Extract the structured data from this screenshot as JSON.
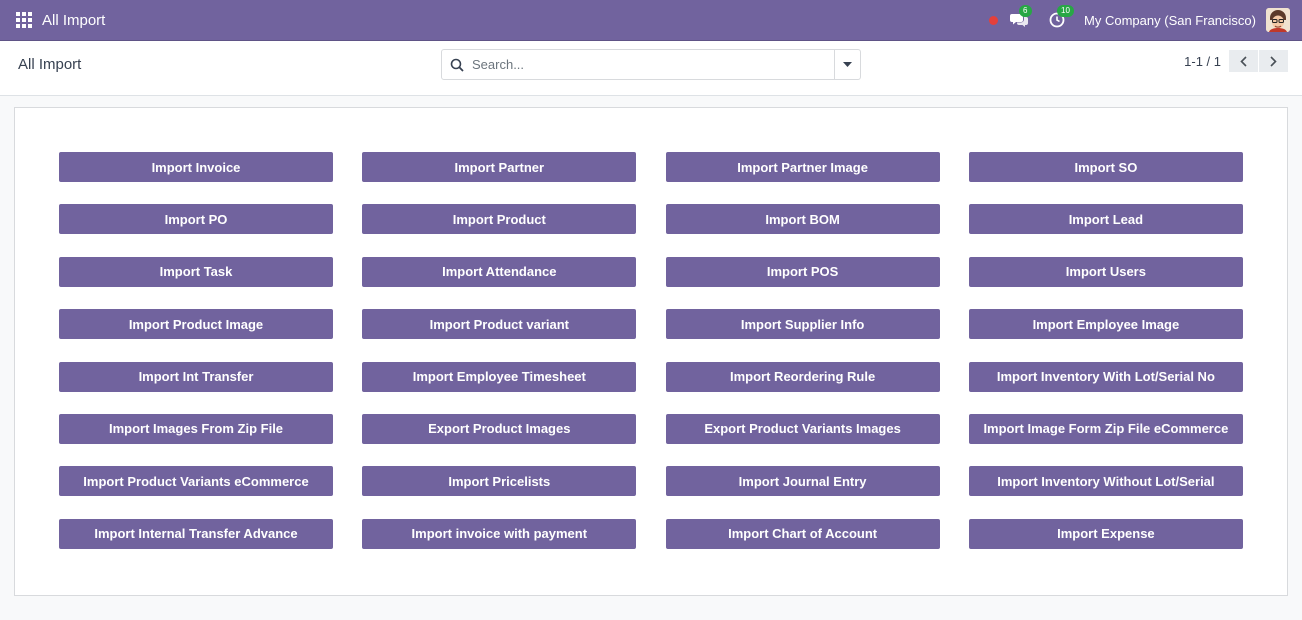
{
  "navbar": {
    "app_title": "All Import",
    "messages_count": "6",
    "activities_count": "10",
    "company": "My Company (San Francisco)"
  },
  "control_panel": {
    "breadcrumb": "All Import",
    "search_placeholder": "Search...",
    "pager": "1-1 / 1"
  },
  "buttons": [
    "Import Invoice",
    "Import Partner",
    "Import Partner Image",
    "Import SO",
    "Import PO",
    "Import Product",
    "Import BOM",
    "Import Lead",
    "Import Task",
    "Import Attendance",
    "Import POS",
    "Import Users",
    "Import Product Image",
    "Import Product variant",
    "Import Supplier Info",
    "Import Employee Image",
    "Import Int Transfer",
    "Import Employee Timesheet",
    "Import Reordering Rule",
    "Import Inventory With Lot/Serial No",
    "Import Images From Zip File",
    "Export Product Images",
    "Export Product Variants Images",
    "Import Image Form Zip File eCommerce",
    "Import Product Variants eCommerce",
    "Import Pricelists",
    "Import Journal Entry",
    "Import Inventory Without Lot/Serial",
    "Import Internal Transfer Advance",
    "Import invoice with payment",
    "Import Chart of Account",
    "Import Expense"
  ],
  "colors": {
    "brand": "#71639e",
    "badge": "#28a745",
    "recording": "#e4403b"
  }
}
